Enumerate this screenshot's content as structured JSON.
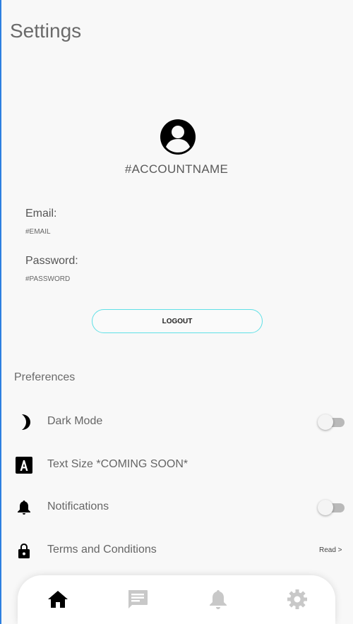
{
  "header": {
    "title": "Settings"
  },
  "account": {
    "avatar_icon": "account-circle-icon",
    "name": "#ACCOUNTNAME",
    "email_label": "Email:",
    "email_value": "#EMAIL",
    "password_label": "Password:",
    "password_value": "#PASSWORD",
    "logout_label": "LOGOUT",
    "accent_color": "#5fe0e6"
  },
  "preferences": {
    "heading": "Preferences",
    "items": [
      {
        "icon": "moon-icon",
        "label": "Dark Mode",
        "control": "toggle",
        "enabled": false
      },
      {
        "icon": "text-size-icon",
        "label": "Text Size *COMING SOON*",
        "control": "none"
      },
      {
        "icon": "bell-icon",
        "label": "Notifications",
        "control": "toggle",
        "enabled": false
      },
      {
        "icon": "lock-icon",
        "label": "Terms and Conditions",
        "control": "link",
        "link_label": "Read >"
      }
    ]
  },
  "bottom_nav": {
    "items": [
      {
        "icon": "home-icon",
        "active": true
      },
      {
        "icon": "chat-icon",
        "active": false
      },
      {
        "icon": "bell-icon",
        "active": false
      },
      {
        "icon": "gear-icon",
        "active": false
      }
    ],
    "active_color": "#000000",
    "inactive_color": "#c8c8c8"
  }
}
